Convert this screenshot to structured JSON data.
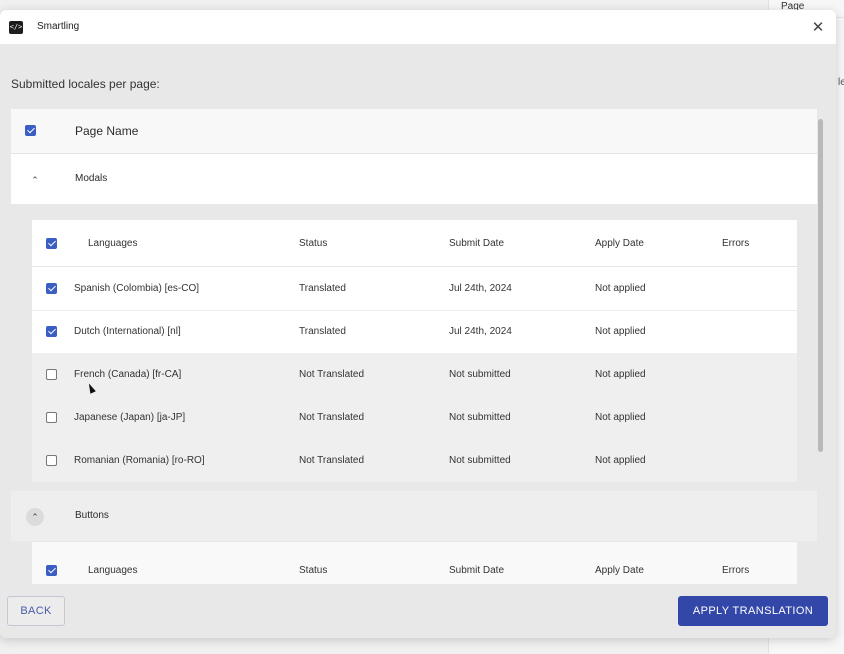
{
  "background": {
    "page_title": "Page",
    "fragment": "le"
  },
  "header": {
    "logo_glyph": "</>",
    "app_name": "Smartling",
    "close_glyph": "✕"
  },
  "section_label": "Submitted locales per page:",
  "table": {
    "select_all_checked": true,
    "page_name_header": "Page Name",
    "groups": [
      {
        "name": "Modals",
        "expanded": true,
        "columns": {
          "languages": "Languages",
          "status": "Status",
          "submit_date": "Submit Date",
          "apply_date": "Apply Date",
          "errors": "Errors"
        },
        "rows": [
          {
            "checked": true,
            "language": "Spanish (Colombia) [es-CO]",
            "status": "Translated",
            "submit_date": "Jul 24th, 2024",
            "apply_date": "Not applied",
            "errors": ""
          },
          {
            "checked": true,
            "language": "Dutch (International) [nl]",
            "status": "Translated",
            "submit_date": "Jul 24th, 2024",
            "apply_date": "Not applied",
            "errors": ""
          },
          {
            "checked": false,
            "language": "French (Canada) [fr-CA]",
            "status": "Not Translated",
            "submit_date": "Not submitted",
            "apply_date": "Not applied",
            "errors": ""
          },
          {
            "checked": false,
            "language": "Japanese (Japan) [ja-JP]",
            "status": "Not Translated",
            "submit_date": "Not submitted",
            "apply_date": "Not applied",
            "errors": ""
          },
          {
            "checked": false,
            "language": "Romanian (Romania) [ro-RO]",
            "status": "Not Translated",
            "submit_date": "Not submitted",
            "apply_date": "Not applied",
            "errors": ""
          }
        ]
      },
      {
        "name": "Buttons",
        "expanded": true,
        "columns": {
          "languages": "Languages",
          "status": "Status",
          "submit_date": "Submit Date",
          "apply_date": "Apply Date",
          "errors": "Errors"
        }
      }
    ]
  },
  "footer": {
    "back_label": "BACK",
    "apply_label": "APPLY TRANSLATION"
  },
  "colors": {
    "accent": "#3347a8",
    "checkbox": "#3a5ec4"
  },
  "icons": {
    "chevron": "⌃"
  }
}
